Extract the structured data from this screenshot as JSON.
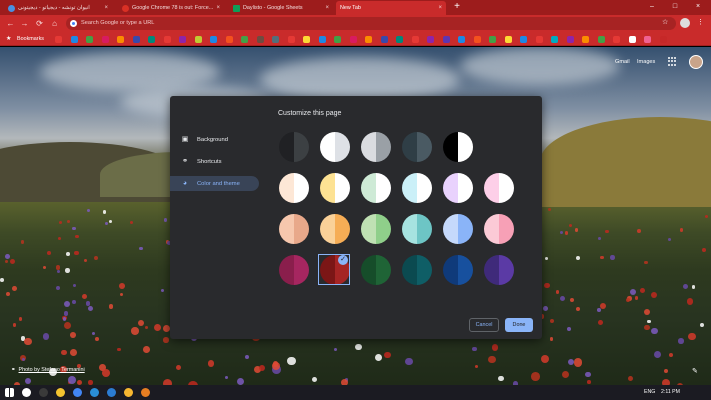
{
  "tabs": [
    {
      "title": "انیوان تونشه - دیجیاتو - دیجیتونی",
      "favicon_color": "#4a90e2"
    },
    {
      "title": "Google Chrome 78 is out: Force...",
      "favicon_color": "#d93025"
    },
    {
      "title": "Daylisto - Google Sheets",
      "favicon_color": "#0f9d58"
    },
    {
      "title": "New Tab",
      "favicon_color": ""
    }
  ],
  "tab_close_glyph": "×",
  "new_tab_glyph": "+",
  "window_controls": {
    "minimize": "–",
    "maximize": "□",
    "close": "×"
  },
  "toolbar": {
    "back": "←",
    "forward": "→",
    "reload": "⟳",
    "home": "⌂",
    "omnibox_placeholder": "Search Google or type a URL",
    "star": "☆",
    "menu": "⋮"
  },
  "bookmarks": {
    "star": "★",
    "label": "Bookmarks",
    "icon_colors": [
      "#e53935",
      "#1e88e5",
      "#43a047",
      "#d81b60",
      "#fb8c00",
      "#3949ab",
      "#00897b",
      "#e53935",
      "#8e24aa",
      "#c0ca33",
      "#1e88e5",
      "#f4511e",
      "#43a047",
      "#6d4c41",
      "#546e7a",
      "#e53935",
      "#fdd835",
      "#1e88e5",
      "#43a047",
      "#d81b60",
      "#fb8c00",
      "#3949ab",
      "#00897b",
      "#e53935",
      "#8e24aa",
      "#5e35b1",
      "#1e88e5",
      "#f4511e",
      "#43a047",
      "#fdd835",
      "#1e88e5",
      "#e53935",
      "#00acc1",
      "#8e24aa",
      "#fb8c00",
      "#43a047",
      "#e53935",
      "#ffffff",
      "#f06292",
      "#c62828"
    ]
  },
  "top_links": {
    "gmail": "Gmail",
    "images": "Images"
  },
  "dialog": {
    "title": "Customize this page",
    "sidebar": [
      {
        "label": "Background",
        "icon": "▣"
      },
      {
        "label": "Shortcuts",
        "icon": "⚭"
      },
      {
        "label": "Color and theme",
        "icon": "◕"
      }
    ],
    "selected_item": "Color and theme",
    "swatches": [
      [
        "#202124",
        "#3c4043"
      ],
      [
        "#ffffff",
        "#dee1e6"
      ],
      [
        "#dadce0",
        "#9aa0a6"
      ],
      [
        "#2f3e46",
        "#4a5a63"
      ],
      [
        "#000000",
        "#ffffff"
      ],
      [
        "#fde7d6",
        "#ffffff"
      ],
      [
        "#fde293",
        "#ffffff"
      ],
      [
        "#ceead6",
        "#ffffff"
      ],
      [
        "#cbf0f8",
        "#ffffff"
      ],
      [
        "#e9d2fd",
        "#ffffff"
      ],
      [
        "#fdcfe8",
        "#ffffff"
      ],
      [
        "#f6c7ad",
        "#e8a88a"
      ],
      [
        "#fad198",
        "#f6ad55"
      ],
      [
        "#bfe1b3",
        "#8fcf8a"
      ],
      [
        "#a6e3e0",
        "#6dc5c5"
      ],
      [
        "#c5d9fb",
        "#8ab4f8"
      ],
      [
        "#fbcad6",
        "#f7a0b6"
      ],
      [
        "#8a1e4c",
        "#a62660"
      ],
      [
        "#7b1616",
        "#a52424"
      ],
      [
        "#164d2a",
        "#1f6436"
      ],
      [
        "#0b4a50",
        "#0f5e66"
      ],
      [
        "#0f3a7a",
        "#17509e"
      ],
      [
        "#3f2a7a",
        "#5b3aa5"
      ]
    ],
    "selected_swatch": "Dark red",
    "check_glyph": "✓",
    "cancel": "Cancel",
    "done": "Done"
  },
  "photo_credit": "Photo by Stefano Termanini",
  "edit_glyph": "✎",
  "taskbar": {
    "icon_colors": [
      "#ffffff",
      "#3a3a3a",
      "#f4c430",
      "#4285f4",
      "#2a8ed6",
      "#2b7cd3",
      "#f7b731",
      "#e67e22"
    ],
    "language": "ENG",
    "time": "2:11 PM",
    "date": ""
  }
}
